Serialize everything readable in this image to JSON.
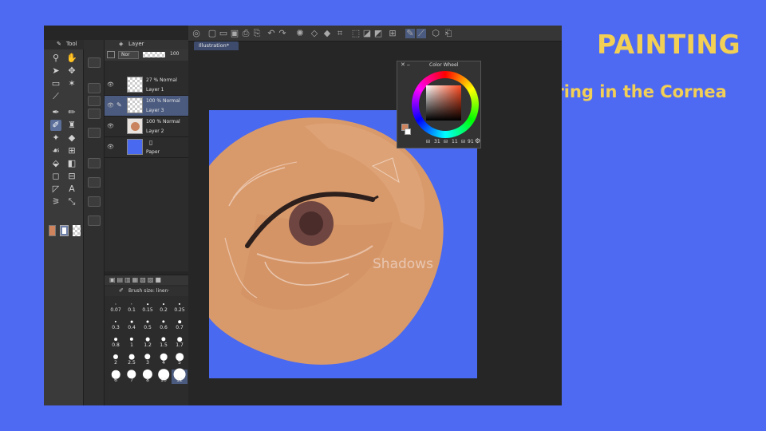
{
  "slide": {
    "title": "PAINTING",
    "subtitle": "Colouring in the Cornea"
  },
  "panels": {
    "tool_title": "Tool",
    "layer_title": "Layer",
    "brush_title": "Brush size: linen·",
    "layer_mode": "Nor",
    "layer_opacity": "100",
    "color_wheel_title": "Color Wheel",
    "color_values": [
      "31",
      "11",
      "91"
    ]
  },
  "document": {
    "tab_label": "Illustration*"
  },
  "layers": [
    {
      "opacity": "27 %",
      "mode": "Normal",
      "name": "Layer 1",
      "thumb": "checker",
      "selected": false
    },
    {
      "opacity": "100 %",
      "mode": "Normal",
      "name": "Layer 3",
      "thumb": "checker",
      "selected": true
    },
    {
      "opacity": "100 %",
      "mode": "Normal",
      "name": "Layer 2",
      "thumb": "eye",
      "selected": false
    },
    {
      "opacity": "",
      "mode": "",
      "name": "Paper",
      "thumb": "paper",
      "selected": false
    }
  ],
  "brush_sizes": [
    "0.07",
    "0.1",
    "0.15",
    "0.2",
    "0.25",
    "0.3",
    "0.4",
    "0.5",
    "0.6",
    "0.7",
    "0.8",
    "1",
    "1.2",
    "1.5",
    "1.7",
    "2",
    "2.5",
    "3",
    "4",
    "5",
    "6",
    "7",
    "8",
    "10",
    "12"
  ],
  "brush_selected": "12",
  "canvas_annotation": "Shadows",
  "colors": {
    "slide_bg": "#4f6af2",
    "title_yellow": "#f2cf55",
    "canvas_blue": "#4969f0",
    "skin": "#d99a6b",
    "current_color": "#d0845e"
  }
}
